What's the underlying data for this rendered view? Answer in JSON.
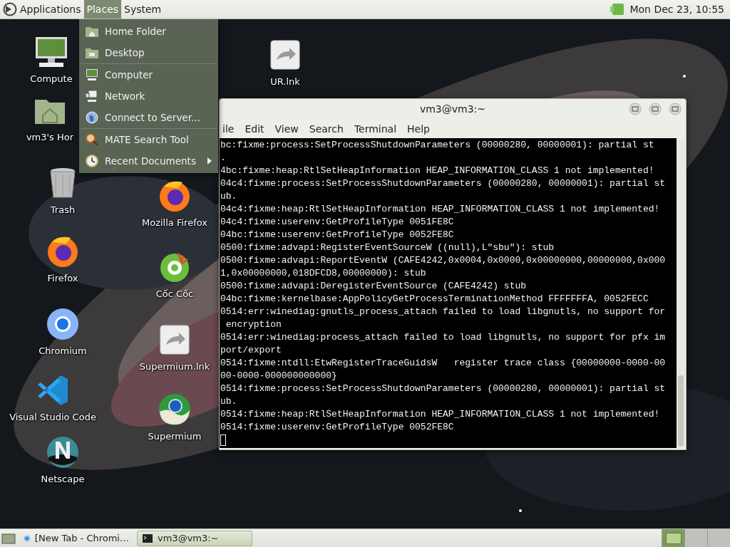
{
  "top_panel": {
    "menus": [
      {
        "label": "Applications",
        "selected": false,
        "logo": true
      },
      {
        "label": "Places",
        "selected": true,
        "logo": false
      },
      {
        "label": "System",
        "selected": false,
        "logo": false
      }
    ],
    "clock": "Mon Dec 23, 10:55"
  },
  "places_menu": {
    "groups": [
      [
        {
          "label": "Home Folder",
          "kind": "home",
          "submenu": false
        },
        {
          "label": "Desktop",
          "kind": "desktop",
          "submenu": false
        }
      ],
      [
        {
          "label": "Computer",
          "kind": "computer",
          "submenu": false
        },
        {
          "label": "Network",
          "kind": "network",
          "submenu": false
        },
        {
          "label": "Connect to Server...",
          "kind": "server",
          "submenu": false
        }
      ],
      [
        {
          "label": "MATE Search Tool",
          "kind": "search",
          "submenu": false
        },
        {
          "label": "Recent Documents",
          "kind": "recent",
          "submenu": true
        }
      ]
    ]
  },
  "desktop_icons": [
    {
      "label": "Compute",
      "kind": "computer"
    },
    {
      "label": "vm3's Hor",
      "kind": "home"
    },
    {
      "label": "Trash",
      "kind": "trash"
    },
    {
      "label": "Firefox",
      "kind": "firefox"
    },
    {
      "label": "Chromium",
      "kind": "chromium"
    },
    {
      "label": "Visual Studio Code",
      "kind": "vscode"
    },
    {
      "label": "Netscape",
      "kind": "netscape"
    },
    {
      "label": "UR.lnk",
      "kind": "shortcut"
    },
    {
      "label": "Mozilla Firefox",
      "kind": "firefox"
    },
    {
      "label": "Cốc Cốc",
      "kind": "coccoc"
    },
    {
      "label": "Supermium.lnk",
      "kind": "shortcut"
    },
    {
      "label": "Supermium",
      "kind": "supermium"
    }
  ],
  "terminal": {
    "title": "vm3@vm3:~",
    "menu": [
      "ile",
      "Edit",
      "View",
      "Search",
      "Terminal",
      "Help"
    ],
    "lines": [
      "bc:fixme:process:SetProcessShutdownParameters (00000280, 00000001): partial st",
      ".",
      "4bc:fixme:heap:RtlSetHeapInformation HEAP_INFORMATION_CLASS 1 not implemented!",
      "04c4:fixme:process:SetProcessShutdownParameters (00000280, 00000001): partial st",
      "ub.",
      "04c4:fixme:heap:RtlSetHeapInformation HEAP_INFORMATION_CLASS 1 not implemented!",
      "04c4:fixme:userenv:GetProfileType 0051FE8C",
      "04bc:fixme:userenv:GetProfileType 0052FE8C",
      "0500:fixme:advapi:RegisterEventSourceW ((null),L\"sbu\"): stub",
      "0500:fixme:advapi:ReportEventW (CAFE4242,0x0004,0x0000,0x00000000,00000000,0x000",
      "1,0x00000000,018DFCD8,00000000): stub",
      "0500:fixme:advapi:DeregisterEventSource (CAFE4242) stub",
      "04bc:fixme:kernelbase:AppPolicyGetProcessTerminationMethod FFFFFFFA, 0052FECC",
      "0514:err:winediag:gnutls_process_attach failed to load libgnutls, no support for",
      " encryption",
      "0514:err:winediag:process_attach failed to load libgnutls, no support for pfx im",
      "port/export",
      "0514:fixme:ntdll:EtwRegisterTraceGuidsW   register trace class {00000000-0000-00",
      "00-0000-000000000000}",
      "0514:fixme:process:SetProcessShutdownParameters (00000280, 00000001): partial st",
      "ub.",
      "0514:fixme:heap:RtlSetHeapInformation HEAP_INFORMATION_CLASS 1 not implemented!",
      "0514:fixme:userenv:GetProfileType 0052FE8C"
    ]
  },
  "taskbar": {
    "tasks": [
      {
        "label": "[New Tab - Chromi…",
        "kind": "browser",
        "selected": false
      },
      {
        "label": "vm3@vm3:~",
        "kind": "terminal",
        "selected": true
      }
    ],
    "workspaces": [
      {
        "selected": true
      },
      {
        "selected": false
      },
      {
        "selected": false
      }
    ]
  }
}
